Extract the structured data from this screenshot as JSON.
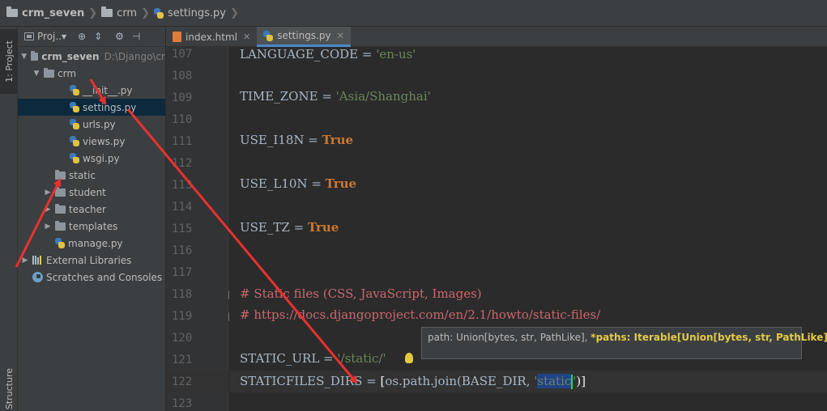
{
  "breadcrumb": {
    "project": "crm_seven",
    "folder": "crm",
    "file": "settings.py"
  },
  "tool_stripe": {
    "project_label": "1: Project",
    "structure_label": "Structure"
  },
  "project_panel": {
    "title": "Proj..▾",
    "tree": [
      {
        "label": "crm_seven",
        "path": "D:\\Django\\cr",
        "type": "root",
        "expanded": true
      },
      {
        "label": "crm",
        "type": "dir",
        "expanded": true
      },
      {
        "label": "__init__.py",
        "type": "py"
      },
      {
        "label": "settings.py",
        "type": "py",
        "selected": true
      },
      {
        "label": "urls.py",
        "type": "py"
      },
      {
        "label": "views.py",
        "type": "py"
      },
      {
        "label": "wsgi.py",
        "type": "py"
      },
      {
        "label": "static",
        "type": "dir"
      },
      {
        "label": "student",
        "type": "dir",
        "collapsed": true
      },
      {
        "label": "teacher",
        "type": "dir",
        "collapsed": true
      },
      {
        "label": "templates",
        "type": "dir",
        "collapsed": true
      },
      {
        "label": "manage.py",
        "type": "py"
      },
      {
        "label": "External Libraries",
        "type": "lib",
        "collapsed": true
      },
      {
        "label": "Scratches and Consoles",
        "type": "scratch"
      }
    ]
  },
  "editor_tabs": [
    {
      "label": "index.html",
      "active": false
    },
    {
      "label": "settings.py",
      "active": true
    }
  ],
  "line_numbers": [
    "107",
    "108",
    "109",
    "110",
    "111",
    "112",
    "113",
    "114",
    "115",
    "116",
    "117",
    "118",
    "119",
    "120",
    "121",
    "122",
    "123"
  ],
  "code": {
    "l107_name": "LANGUAGE_CODE",
    "l107_eq": " = ",
    "l107_val": "'en-us'",
    "l109_name": "TIME_ZONE",
    "l109_eq": " = ",
    "l109_val": "'Asia/Shanghai'",
    "l111_name": "USE_I18N",
    "l111_eq": " = ",
    "l111_val": "True",
    "l113_name": "USE_L10N",
    "l113_eq": " = ",
    "l113_val": "True",
    "l115_name": "USE_TZ",
    "l115_eq": " = ",
    "l115_val": "True",
    "l118_comment": "# Static files (CSS, JavaScript, Images)",
    "l119_comment": "# https://docs.djangoproject.com/en/2.1/howto/static-files/",
    "l121_name": "STATIC_URL",
    "l121_eq": " = ",
    "l121_val": "'/static/'",
    "l122_name": "STATICFILES_DIRS",
    "l122_eq": " = ",
    "l122_open": "[",
    "l122_call": "os.path.join(BASE_DIR, ",
    "l122_q1": "'",
    "l122_sel": "static",
    "l122_q2": "'",
    "l122_close": ")]"
  },
  "tooltip": {
    "plain": "path: Union[bytes, str, PathLike], ",
    "highlight": "*paths: Iterable[Union[bytes, str, PathLike]]"
  },
  "colors": {
    "annotation_arrow": "#e8312f",
    "keyword": "#cc7832",
    "string": "#6a8759",
    "comment": "#cc666e",
    "tooltip_highlight": "#e3c943"
  }
}
